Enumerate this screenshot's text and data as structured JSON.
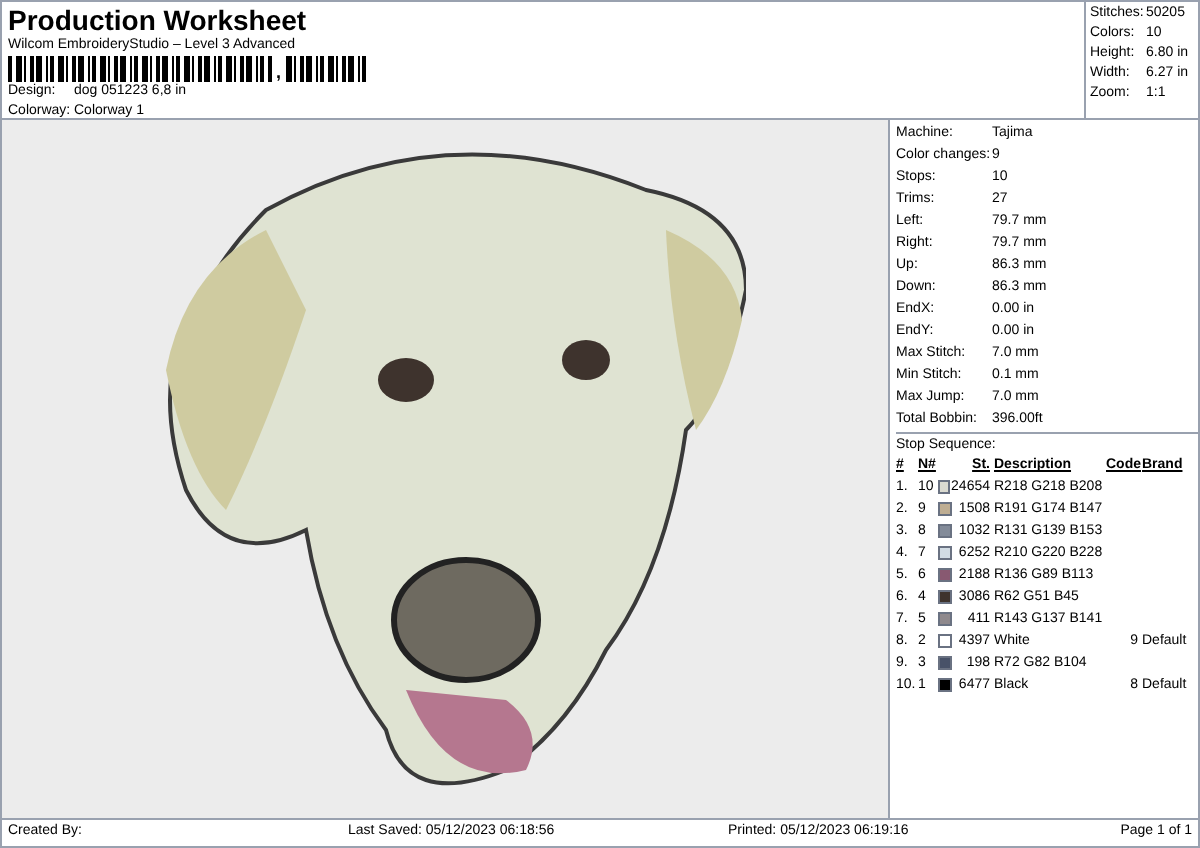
{
  "header": {
    "title": "Production Worksheet",
    "subtitle": "Wilcom EmbroideryStudio – Level 3 Advanced",
    "barcode_mark": ",",
    "fields": [
      {
        "label": "Design:",
        "value": "dog 051223 6,8 in"
      },
      {
        "label": "Colorway:",
        "value": "Colorway 1"
      }
    ]
  },
  "summary": [
    {
      "label": "Stitches:",
      "value": "50205"
    },
    {
      "label": "Colors:",
      "value": "10"
    },
    {
      "label": "Height:",
      "value": "6.80 in"
    },
    {
      "label": "Width:",
      "value": "6.27 in"
    },
    {
      "label": "Zoom:",
      "value": "1:1"
    }
  ],
  "details": [
    {
      "label": "Machine:",
      "value": "Tajima"
    },
    {
      "label": "Color changes:",
      "value": "9"
    },
    {
      "label": "Stops:",
      "value": "10"
    },
    {
      "label": "Trims:",
      "value": "27"
    },
    {
      "label": "Left:",
      "value": "79.7 mm"
    },
    {
      "label": "Right:",
      "value": "79.7 mm"
    },
    {
      "label": "Up:",
      "value": "86.3 mm"
    },
    {
      "label": "Down:",
      "value": "86.3 mm"
    },
    {
      "label": "EndX:",
      "value": "0.00 in"
    },
    {
      "label": "EndY:",
      "value": "0.00 in"
    },
    {
      "label": "Max Stitch:",
      "value": "7.0 mm"
    },
    {
      "label": "Min Stitch:",
      "value": "0.1 mm"
    },
    {
      "label": "Max Jump:",
      "value": "7.0 mm"
    },
    {
      "label": "Total Bobbin:",
      "value": "396.00ft"
    }
  ],
  "stop_sequence": {
    "title": "Stop Sequence:",
    "columns": [
      "#",
      "N#",
      "St.",
      "Description",
      "Code",
      "Brand"
    ],
    "rows": [
      {
        "index": "1.",
        "n": "10",
        "color": "#dadad0",
        "stitches": "24654",
        "description": "R218 G218 B208",
        "code": "",
        "brand": ""
      },
      {
        "index": "2.",
        "n": "9",
        "color": "#bfae93",
        "stitches": "1508",
        "description": "R191 G174 B147",
        "code": "",
        "brand": ""
      },
      {
        "index": "3.",
        "n": "8",
        "color": "#838b99",
        "stitches": "1032",
        "description": "R131 G139 B153",
        "code": "",
        "brand": ""
      },
      {
        "index": "4.",
        "n": "7",
        "color": "#d2dce4",
        "stitches": "6252",
        "description": "R210 G220 B228",
        "code": "",
        "brand": ""
      },
      {
        "index": "5.",
        "n": "6",
        "color": "#885971",
        "stitches": "2188",
        "description": "R136 G89 B113",
        "code": "",
        "brand": ""
      },
      {
        "index": "6.",
        "n": "4",
        "color": "#3e332d",
        "stitches": "3086",
        "description": "R62 G51 B45",
        "code": "",
        "brand": ""
      },
      {
        "index": "7.",
        "n": "5",
        "color": "#8f898d",
        "stitches": "411",
        "description": "R143 G137 B141",
        "code": "",
        "brand": ""
      },
      {
        "index": "8.",
        "n": "2",
        "color": "#ffffff",
        "stitches": "4397",
        "description": "White",
        "code": "9",
        "brand": "Default"
      },
      {
        "index": "9.",
        "n": "3",
        "color": "#485268",
        "stitches": "198",
        "description": "R72 G82 B104",
        "code": "",
        "brand": ""
      },
      {
        "index": "10.",
        "n": "1",
        "color": "#000000",
        "stitches": "6477",
        "description": "Black",
        "code": "8",
        "brand": "Default"
      }
    ]
  },
  "footer": {
    "created_by": "Created By:",
    "last_saved": "Last Saved: 05/12/2023 06:18:56",
    "printed": "Printed: 05/12/2023 06:19:16",
    "page": "Page 1 of 1"
  }
}
